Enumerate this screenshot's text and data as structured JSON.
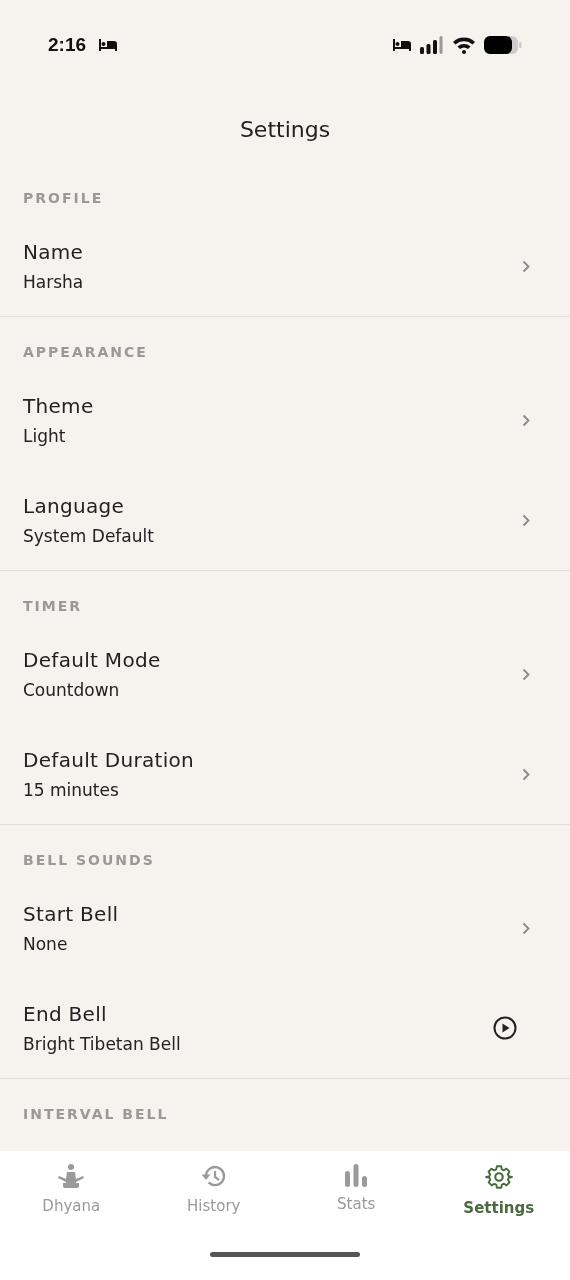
{
  "status_bar": {
    "time": "2:16"
  },
  "title": "Settings",
  "sections": [
    {
      "header": "PROFILE",
      "rows": [
        {
          "kind": "chevron",
          "label": "Name",
          "value": "Harsha"
        }
      ]
    },
    {
      "header": "APPEARANCE",
      "rows": [
        {
          "kind": "chevron",
          "label": "Theme",
          "value": "Light"
        },
        {
          "kind": "chevron",
          "label": "Language",
          "value": "System Default"
        }
      ]
    },
    {
      "header": "TIMER",
      "rows": [
        {
          "kind": "chevron",
          "label": "Default Mode",
          "value": "Countdown"
        },
        {
          "kind": "chevron",
          "label": "Default Duration",
          "value": "15 minutes"
        }
      ]
    },
    {
      "header": "BELL SOUNDS",
      "rows": [
        {
          "kind": "chevron",
          "label": "Start Bell",
          "value": "None"
        },
        {
          "kind": "play",
          "label": "End Bell",
          "value": "Bright Tibetan Bell"
        }
      ]
    },
    {
      "header": "INTERVAL BELL"
    }
  ],
  "nav": [
    {
      "kind": "meditation",
      "label": "Dhyana",
      "selected": false
    },
    {
      "kind": "history",
      "label": "History",
      "selected": false
    },
    {
      "kind": "stats",
      "label": "Stats",
      "selected": false
    },
    {
      "kind": "settings",
      "label": "Settings",
      "selected": true
    }
  ]
}
